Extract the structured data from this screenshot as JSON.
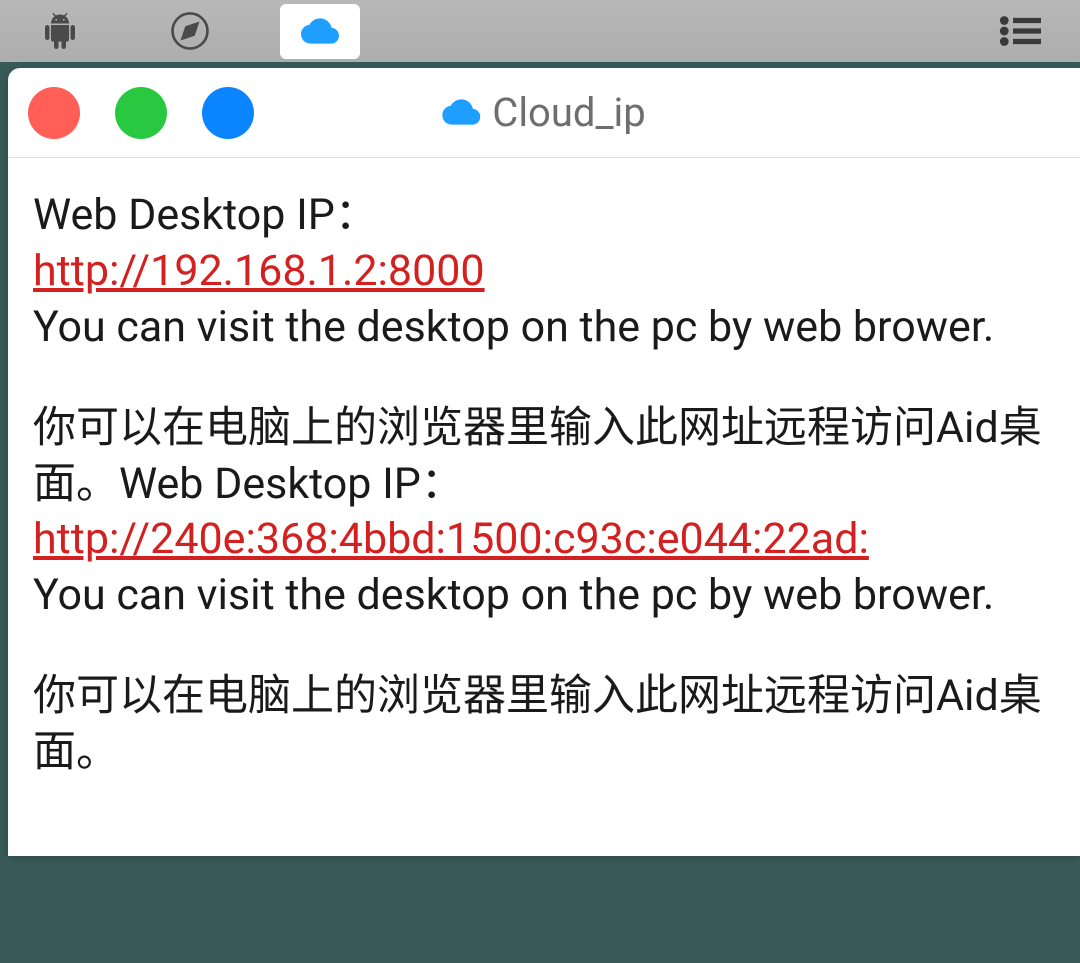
{
  "window": {
    "title": "Cloud_ip"
  },
  "content": {
    "block1": {
      "label": "Web Desktop IP：",
      "url": "http://192.168.1.2:8000",
      "desc": "You can visit the desktop on the pc by web brower."
    },
    "block2": {
      "cn_text": "你可以在电脑上的浏览器里输入此网址远程访问Aid桌面。",
      "label": "Web Desktop IP：",
      "url": "http://240e:368:4bbd:1500:c93c:e044:22ad:",
      "desc": "You can visit the desktop on the pc by web brower."
    },
    "block3": {
      "cn_text": "你可以在电脑上的浏览器里输入此网址远程访问Aid桌面。"
    }
  }
}
